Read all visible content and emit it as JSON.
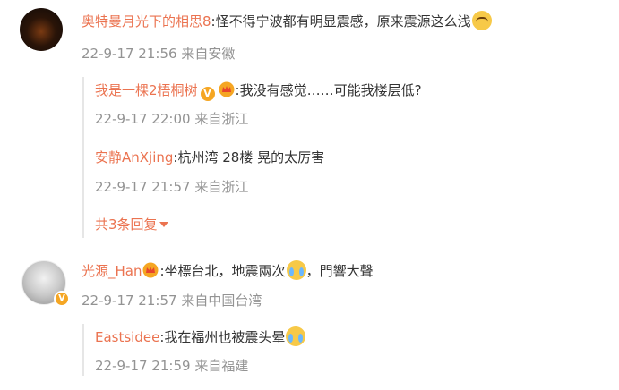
{
  "comments": [
    {
      "user": "奥特曼月光下的相思8",
      "sep": ":",
      "text": "怪不得宁波都有明显震感，原来震源这么浅",
      "time": "22-9-17 21:56",
      "location": "来自安徽",
      "replies": [
        {
          "user": "我是一棵2梧桐树",
          "sep": ":",
          "text": "我没有感觉……可能我楼层低?",
          "time": "22-9-17 22:00",
          "location": "来自浙江"
        },
        {
          "user": "安静AnXjing",
          "sep": ":",
          "text": "杭州湾 28楼  晃的太厉害",
          "time": "22-9-17 21:57",
          "location": "来自浙江"
        }
      ],
      "more_replies": "共3条回复"
    },
    {
      "user": "光源_Han",
      "sep": ":",
      "text": "坐標台北，地震兩次",
      "text2": "，門響大聲",
      "time": "22-9-17 21:57",
      "location": "来自中国台湾",
      "replies": [
        {
          "user": "Eastsidee",
          "sep": ":",
          "text": "我在福州也被震头晕",
          "time": "22-9-17 21:59",
          "location": "来自福建"
        }
      ]
    }
  ],
  "badges": {
    "verified": "V"
  },
  "icons": {
    "emoji_1": "crying-laughing-emoji",
    "emoji_2": "crying-emoji",
    "emoji_3": "crying-emoji",
    "crown": "crown-badge-icon"
  },
  "colors": {
    "username": "#eb7350",
    "meta": "#939393",
    "verified_badge": "#f5a623"
  }
}
